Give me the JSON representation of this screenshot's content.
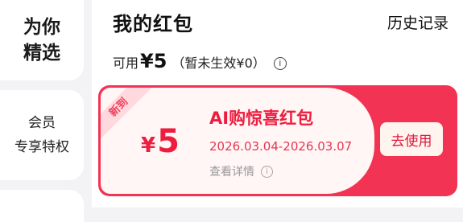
{
  "sidebar": {
    "items": [
      {
        "lines": [
          "为你",
          "精选"
        ]
      },
      {
        "lines": [
          "会员",
          "专享特权"
        ]
      }
    ]
  },
  "header": {
    "title": "我的红包",
    "history_link": "历史记录"
  },
  "summary": {
    "available_prefix": "可用",
    "available_amount": "¥5",
    "pending_text": "（暂未生效¥0）"
  },
  "coupon": {
    "badge": "新到",
    "currency": "¥",
    "amount": "5",
    "title": "AI购惊喜红包",
    "validity": "2026.03.04-2026.03.07",
    "detail_link": "查看详情",
    "use_button": "去使用"
  },
  "colors": {
    "accent_red": "#f33353",
    "coupon_bg": "#fff6f5",
    "badge_bg": "#ffd9dd"
  }
}
